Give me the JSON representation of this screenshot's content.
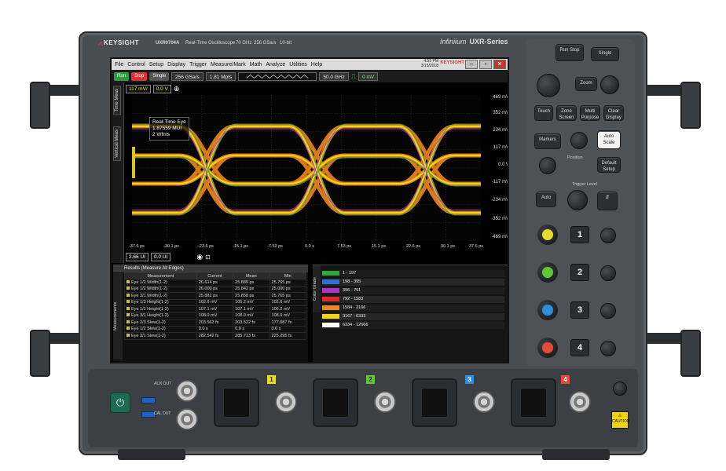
{
  "device": {
    "brand": "KEYSIGHT",
    "model_number": "UXR0704A",
    "description": "Real-Time Oscilloscope",
    "spec1": "70 GHz",
    "spec2": "256 GSa/s",
    "spec3": "10-bit",
    "series_script": "Infiniium",
    "series": "UXR-Series"
  },
  "menu": [
    "File",
    "Control",
    "Setup",
    "Display",
    "Trigger",
    "Measure/Mark",
    "Math",
    "Analyze",
    "Utilities",
    "Help"
  ],
  "titlebar": {
    "time": "4:55 PM",
    "date": "3/15/2018",
    "brand_small": "KEYSIGHT"
  },
  "toolbar": {
    "run": "Run",
    "stop": "Stop",
    "single": "Single",
    "sample_rate": "256 GSa/s",
    "memory": "1.81 Mpts",
    "bandwidth": "50.0 GHz",
    "trigger_level": "0 mV"
  },
  "sidetabs": [
    "Time Meas",
    "Vertical Meas"
  ],
  "vertical": {
    "scale": "117 mV/",
    "offset": "0.0 V"
  },
  "horizontal": {
    "scale": "2.66 UI",
    "position": "0.0 UI"
  },
  "annotation": {
    "line1": "Real-Time Eye",
    "line2": "1.87559 MUI",
    "line3": "2 Wfms"
  },
  "y_ticks": [
    "469 mV",
    "352 mV",
    "234 mV",
    "117 mV",
    "0.0 V",
    "-117 mV",
    "-234 mV",
    "-352 mV",
    "-469 mV"
  ],
  "x_ticks": [
    "-37.6 ps",
    "-30.1 ps",
    "-22.6 ps",
    "-15.1 ps",
    "-7.53 ps",
    "0.0 s",
    "7.53 ps",
    "15.1 ps",
    "22.6 ps",
    "30.1 ps",
    "37.6 ps"
  ],
  "results": {
    "title": "Results (Measure All Edges)",
    "tab": "Measurements",
    "columns": [
      "Measurement",
      "Current",
      "Mean",
      "Min"
    ],
    "rows": [
      [
        "Eye 1/2 Width(1-2)",
        "26.614 ps",
        "25.889 ps",
        "25.765 ps"
      ],
      [
        "Eye 1/2 Width(1-2)",
        "26.000 ps",
        "25.842 ps",
        "25.000 ps"
      ],
      [
        "Eye 3/1 Width(1-2)",
        "25.882 ps",
        "25.858 ps",
        "25.765 ps"
      ],
      [
        "Eye 1/3 Height(1-2)",
        "102.6 mV",
        "105.2 mV",
        "102.6 mV"
      ],
      [
        "Eye 1/2 Height(1-2)",
        "107.1 mV",
        "107.1 mV",
        "106.2 mV"
      ],
      [
        "Eye 3/1 Height(1-2)",
        "108.0 mV",
        "108.0 mV",
        "108.0 mV"
      ],
      [
        "Eye 2/3 Slew(1-2)",
        "203.563 fs",
        "203.522 fs",
        "177.087 fs"
      ],
      [
        "Eye 1/2 Slew(1-2)",
        "0.0 s",
        "0.0 s",
        "0.0 s"
      ],
      [
        "Eye 3/1 Slew(1-2)",
        "282.542 fs",
        "285.713 fs",
        "225.295 fs"
      ]
    ]
  },
  "legend": {
    "tab": "Color Grade",
    "rows": [
      {
        "range": "1 - 197",
        "color": "#2fa83a"
      },
      {
        "range": "198 - 395",
        "color": "#2f6fd6"
      },
      {
        "range": "396 - 791",
        "color": "#b030d0"
      },
      {
        "range": "792 - 1583",
        "color": "#e02a2a"
      },
      {
        "range": "1584 - 3166",
        "color": "#f0861e"
      },
      {
        "range": "3167 - 6333",
        "color": "#f3d21c"
      },
      {
        "range": "6334 - 12666",
        "color": "#ffffff"
      }
    ]
  },
  "panel": {
    "run_stop": "Run Stop",
    "single": "Single",
    "zoom": "Zoom",
    "touch": "Touch",
    "zone_screen": "Zone Screen",
    "multi_purpose": "Multi Purpose",
    "clear_display": "Clear Display",
    "markers": "Markers",
    "auto_scale": "Auto Scale",
    "position": "Position",
    "default_setup": "Default Setup",
    "trigger_level": "Trigger Level",
    "auto": "Auto",
    "ch1": "1",
    "ch2": "2",
    "ch3": "3",
    "ch4": "4"
  },
  "front": {
    "aux_out": "AUX OUT",
    "cal_out": "CAL OUT",
    "ch1": "1",
    "ch2": "2",
    "ch3": "3",
    "ch4": "4",
    "warning": "CAUTION"
  },
  "colors": {
    "ch1": "#e6dd2a",
    "ch2": "#5fc63a",
    "ch3": "#2e8fdc",
    "ch4": "#e84a3a",
    "accent_red": "#e53935",
    "chassis": "#4a4e53"
  }
}
